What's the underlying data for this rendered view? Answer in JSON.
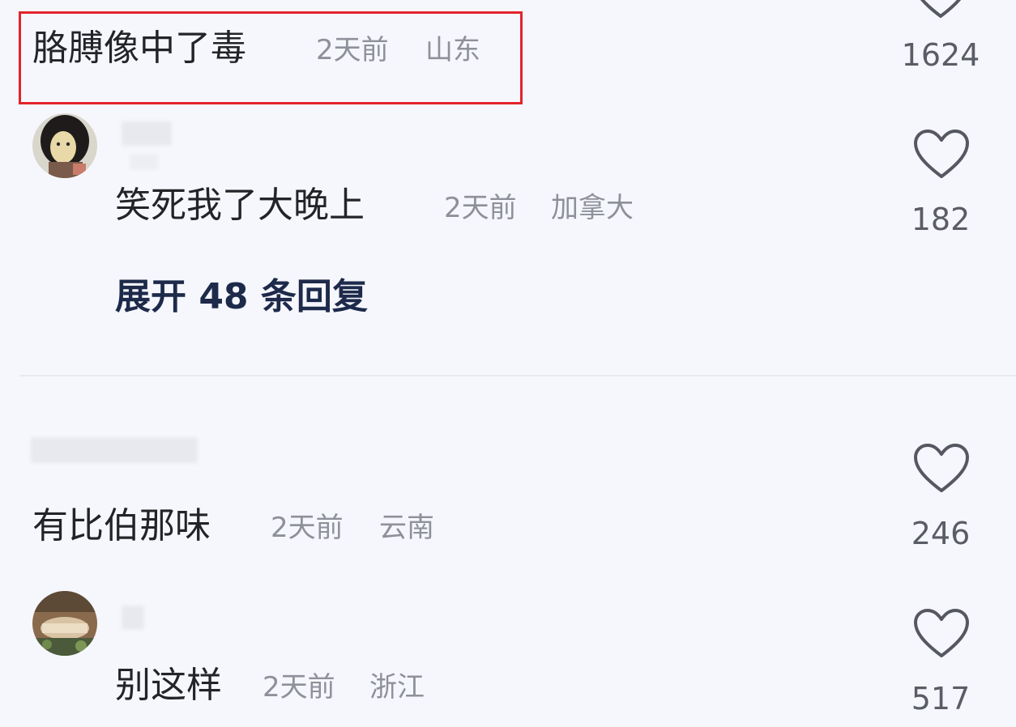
{
  "comments": [
    {
      "text": "胳膊像中了毒",
      "time": "2天前",
      "location": "山东",
      "likes": "1624",
      "highlighted": true
    },
    {
      "text": "笑死我了大晚上",
      "time": "2天前",
      "location": "加拿大",
      "likes": "182",
      "expand_replies": "展开 48 条回复"
    },
    {
      "text": "有比伯那味",
      "time": "2天前",
      "location": "云南",
      "likes": "246"
    },
    {
      "text": "别这样",
      "time": "2天前",
      "location": "浙江",
      "likes": "517"
    }
  ],
  "colors": {
    "background": "#f6f7fc",
    "highlight_border": "#e3232c",
    "comment_text": "#222428",
    "meta_text": "#8e909a",
    "expand_text": "#1d2a4a"
  },
  "icons": {
    "like": "heart-outline-icon"
  }
}
